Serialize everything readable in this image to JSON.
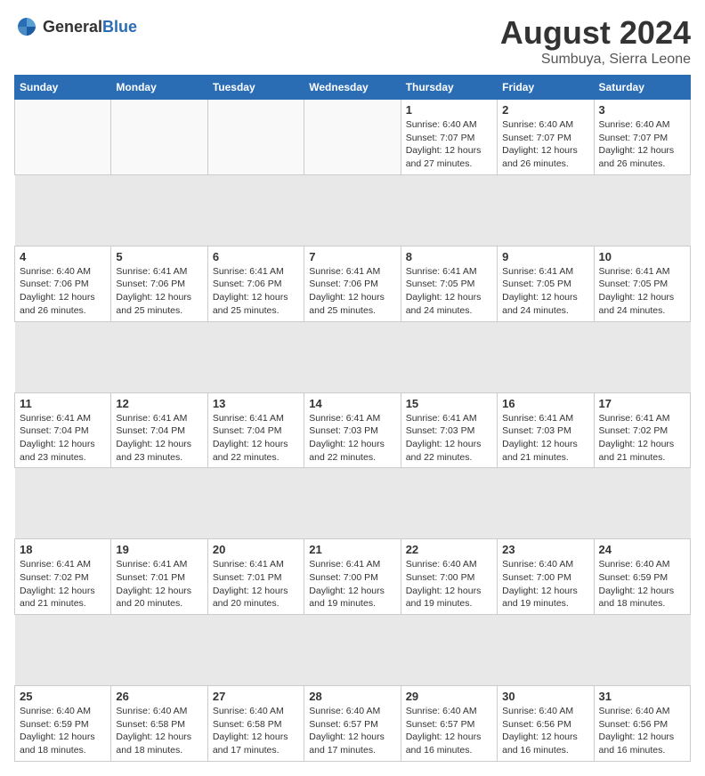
{
  "logo": {
    "general": "General",
    "blue": "Blue"
  },
  "title": "August 2024",
  "subtitle": "Sumbuya, Sierra Leone",
  "weekdays": [
    "Sunday",
    "Monday",
    "Tuesday",
    "Wednesday",
    "Thursday",
    "Friday",
    "Saturday"
  ],
  "weeks": [
    [
      {
        "day": "",
        "info": ""
      },
      {
        "day": "",
        "info": ""
      },
      {
        "day": "",
        "info": ""
      },
      {
        "day": "",
        "info": ""
      },
      {
        "day": "1",
        "info": "Sunrise: 6:40 AM\nSunset: 7:07 PM\nDaylight: 12 hours\nand 27 minutes."
      },
      {
        "day": "2",
        "info": "Sunrise: 6:40 AM\nSunset: 7:07 PM\nDaylight: 12 hours\nand 26 minutes."
      },
      {
        "day": "3",
        "info": "Sunrise: 6:40 AM\nSunset: 7:07 PM\nDaylight: 12 hours\nand 26 minutes."
      }
    ],
    [
      {
        "day": "4",
        "info": "Sunrise: 6:40 AM\nSunset: 7:06 PM\nDaylight: 12 hours\nand 26 minutes."
      },
      {
        "day": "5",
        "info": "Sunrise: 6:41 AM\nSunset: 7:06 PM\nDaylight: 12 hours\nand 25 minutes."
      },
      {
        "day": "6",
        "info": "Sunrise: 6:41 AM\nSunset: 7:06 PM\nDaylight: 12 hours\nand 25 minutes."
      },
      {
        "day": "7",
        "info": "Sunrise: 6:41 AM\nSunset: 7:06 PM\nDaylight: 12 hours\nand 25 minutes."
      },
      {
        "day": "8",
        "info": "Sunrise: 6:41 AM\nSunset: 7:05 PM\nDaylight: 12 hours\nand 24 minutes."
      },
      {
        "day": "9",
        "info": "Sunrise: 6:41 AM\nSunset: 7:05 PM\nDaylight: 12 hours\nand 24 minutes."
      },
      {
        "day": "10",
        "info": "Sunrise: 6:41 AM\nSunset: 7:05 PM\nDaylight: 12 hours\nand 24 minutes."
      }
    ],
    [
      {
        "day": "11",
        "info": "Sunrise: 6:41 AM\nSunset: 7:04 PM\nDaylight: 12 hours\nand 23 minutes."
      },
      {
        "day": "12",
        "info": "Sunrise: 6:41 AM\nSunset: 7:04 PM\nDaylight: 12 hours\nand 23 minutes."
      },
      {
        "day": "13",
        "info": "Sunrise: 6:41 AM\nSunset: 7:04 PM\nDaylight: 12 hours\nand 22 minutes."
      },
      {
        "day": "14",
        "info": "Sunrise: 6:41 AM\nSunset: 7:03 PM\nDaylight: 12 hours\nand 22 minutes."
      },
      {
        "day": "15",
        "info": "Sunrise: 6:41 AM\nSunset: 7:03 PM\nDaylight: 12 hours\nand 22 minutes."
      },
      {
        "day": "16",
        "info": "Sunrise: 6:41 AM\nSunset: 7:03 PM\nDaylight: 12 hours\nand 21 minutes."
      },
      {
        "day": "17",
        "info": "Sunrise: 6:41 AM\nSunset: 7:02 PM\nDaylight: 12 hours\nand 21 minutes."
      }
    ],
    [
      {
        "day": "18",
        "info": "Sunrise: 6:41 AM\nSunset: 7:02 PM\nDaylight: 12 hours\nand 21 minutes."
      },
      {
        "day": "19",
        "info": "Sunrise: 6:41 AM\nSunset: 7:01 PM\nDaylight: 12 hours\nand 20 minutes."
      },
      {
        "day": "20",
        "info": "Sunrise: 6:41 AM\nSunset: 7:01 PM\nDaylight: 12 hours\nand 20 minutes."
      },
      {
        "day": "21",
        "info": "Sunrise: 6:41 AM\nSunset: 7:00 PM\nDaylight: 12 hours\nand 19 minutes."
      },
      {
        "day": "22",
        "info": "Sunrise: 6:40 AM\nSunset: 7:00 PM\nDaylight: 12 hours\nand 19 minutes."
      },
      {
        "day": "23",
        "info": "Sunrise: 6:40 AM\nSunset: 7:00 PM\nDaylight: 12 hours\nand 19 minutes."
      },
      {
        "day": "24",
        "info": "Sunrise: 6:40 AM\nSunset: 6:59 PM\nDaylight: 12 hours\nand 18 minutes."
      }
    ],
    [
      {
        "day": "25",
        "info": "Sunrise: 6:40 AM\nSunset: 6:59 PM\nDaylight: 12 hours\nand 18 minutes."
      },
      {
        "day": "26",
        "info": "Sunrise: 6:40 AM\nSunset: 6:58 PM\nDaylight: 12 hours\nand 18 minutes."
      },
      {
        "day": "27",
        "info": "Sunrise: 6:40 AM\nSunset: 6:58 PM\nDaylight: 12 hours\nand 17 minutes."
      },
      {
        "day": "28",
        "info": "Sunrise: 6:40 AM\nSunset: 6:57 PM\nDaylight: 12 hours\nand 17 minutes."
      },
      {
        "day": "29",
        "info": "Sunrise: 6:40 AM\nSunset: 6:57 PM\nDaylight: 12 hours\nand 16 minutes."
      },
      {
        "day": "30",
        "info": "Sunrise: 6:40 AM\nSunset: 6:56 PM\nDaylight: 12 hours\nand 16 minutes."
      },
      {
        "day": "31",
        "info": "Sunrise: 6:40 AM\nSunset: 6:56 PM\nDaylight: 12 hours\nand 16 minutes."
      }
    ]
  ]
}
